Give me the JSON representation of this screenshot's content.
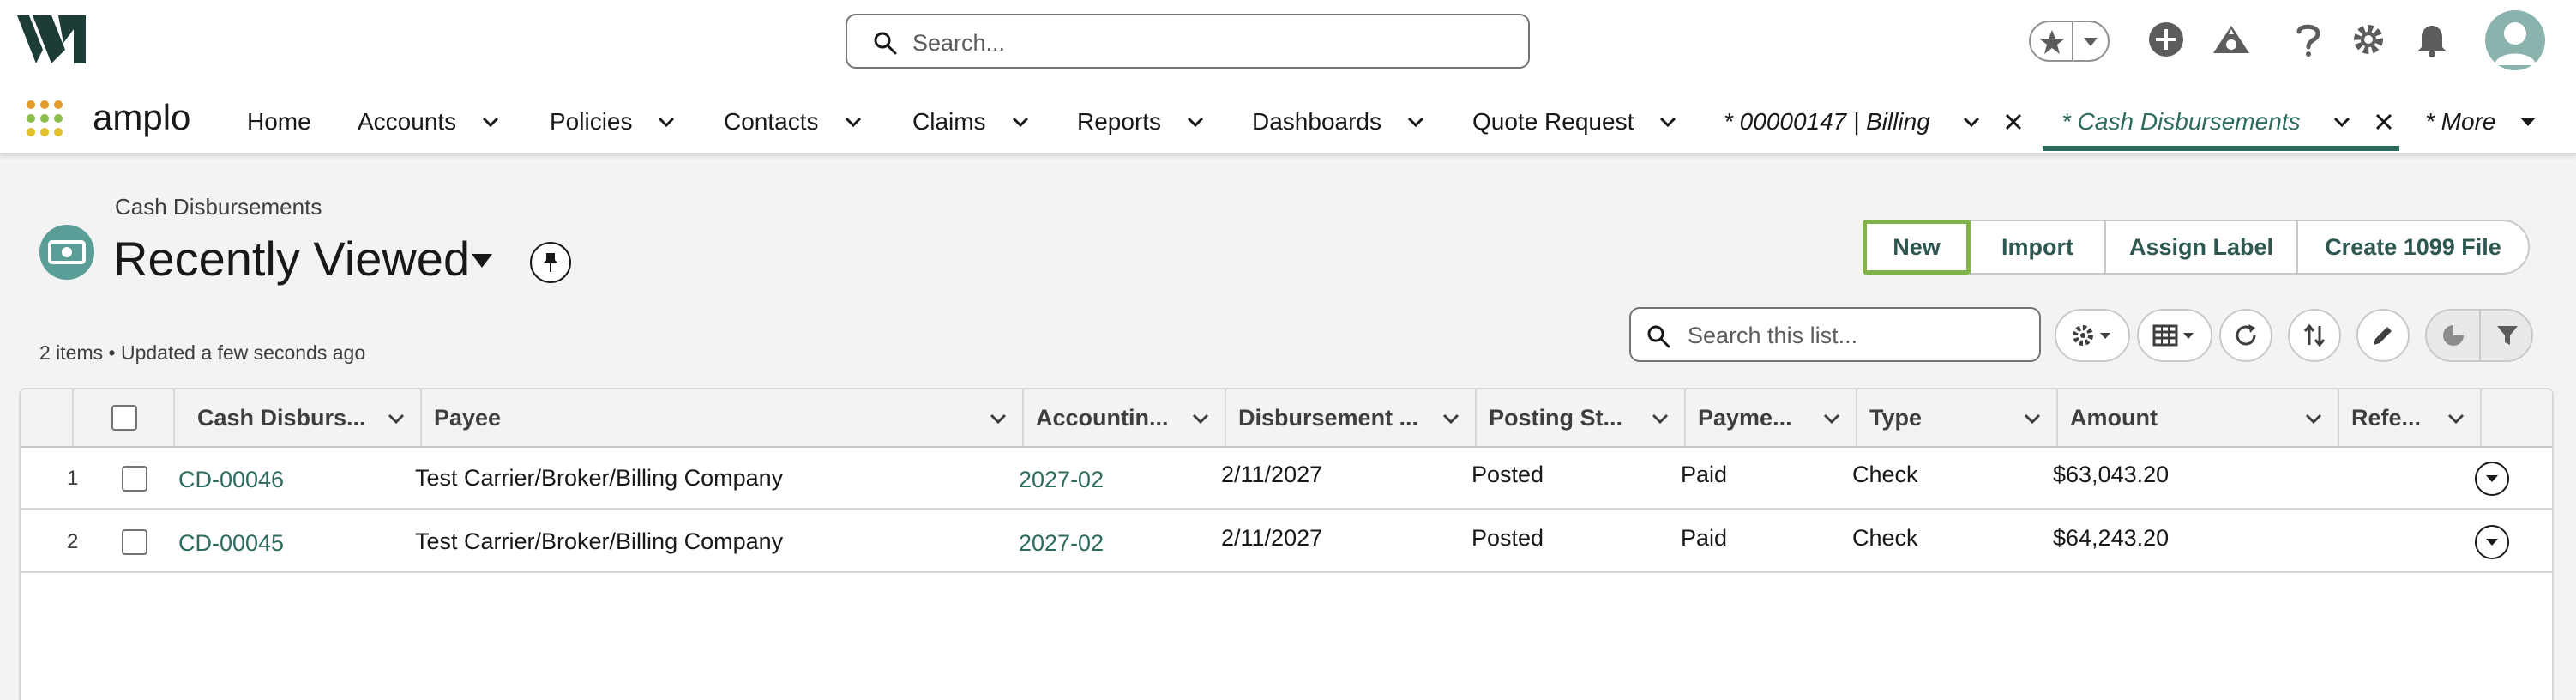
{
  "header": {
    "search_placeholder": "Search..."
  },
  "nav": {
    "app_name": "amplo",
    "items": [
      {
        "label": "Home"
      },
      {
        "label": "Accounts"
      },
      {
        "label": "Policies"
      },
      {
        "label": "Contacts"
      },
      {
        "label": "Claims"
      },
      {
        "label": "Reports"
      },
      {
        "label": "Dashboards"
      },
      {
        "label": "Quote Request"
      }
    ],
    "tabs": [
      {
        "label": "* 00000147 | Billing"
      },
      {
        "label": "* Cash Disbursements"
      }
    ],
    "more_label": "* More"
  },
  "list_header": {
    "object_label": "Cash Disbursements",
    "list_view_name": "Recently Viewed",
    "status": "2 items • Updated a few seconds ago",
    "buttons": {
      "new": "New",
      "import": "Import",
      "assign_label": "Assign Label",
      "create_1099": "Create 1099 File"
    },
    "search_placeholder": "Search this list..."
  },
  "table": {
    "columns": [
      "Cash Disburs...",
      "Payee",
      "Accountin...",
      "Disbursement ...",
      "Posting St...",
      "Payme...",
      "Type",
      "Amount",
      "Refe..."
    ],
    "rows": [
      {
        "num": "1",
        "name": "CD-00046",
        "payee": "Test Carrier/Broker/Billing Company",
        "period": "2027-02",
        "date": "2/11/2027",
        "posting_status": "Posted",
        "payment_status": "Paid",
        "type": "Check",
        "amount": "$63,043.20",
        "reference": ""
      },
      {
        "num": "2",
        "name": "CD-00045",
        "payee": "Test Carrier/Broker/Billing Company",
        "period": "2027-02",
        "date": "2/11/2027",
        "posting_status": "Posted",
        "payment_status": "Paid",
        "type": "Check",
        "amount": "$64,243.20",
        "reference": ""
      }
    ]
  },
  "colors": {
    "brand_dark": "#1d3b37",
    "accent_green": "#2e6b5f",
    "highlight_green": "#80b44a",
    "object_icon": "#5b9e97"
  },
  "icons": [
    "logo-icon",
    "search-icon",
    "star-icon",
    "add-icon",
    "trailhead-icon",
    "help-icon",
    "setup-gear-icon",
    "bell-icon",
    "avatar-icon",
    "app-launcher-icon",
    "chevron-down-icon",
    "close-icon",
    "cash-icon",
    "pin-icon",
    "gear-icon",
    "table-icon",
    "refresh-icon",
    "sort-icon",
    "pencil-icon",
    "chart-icon",
    "filter-icon"
  ]
}
